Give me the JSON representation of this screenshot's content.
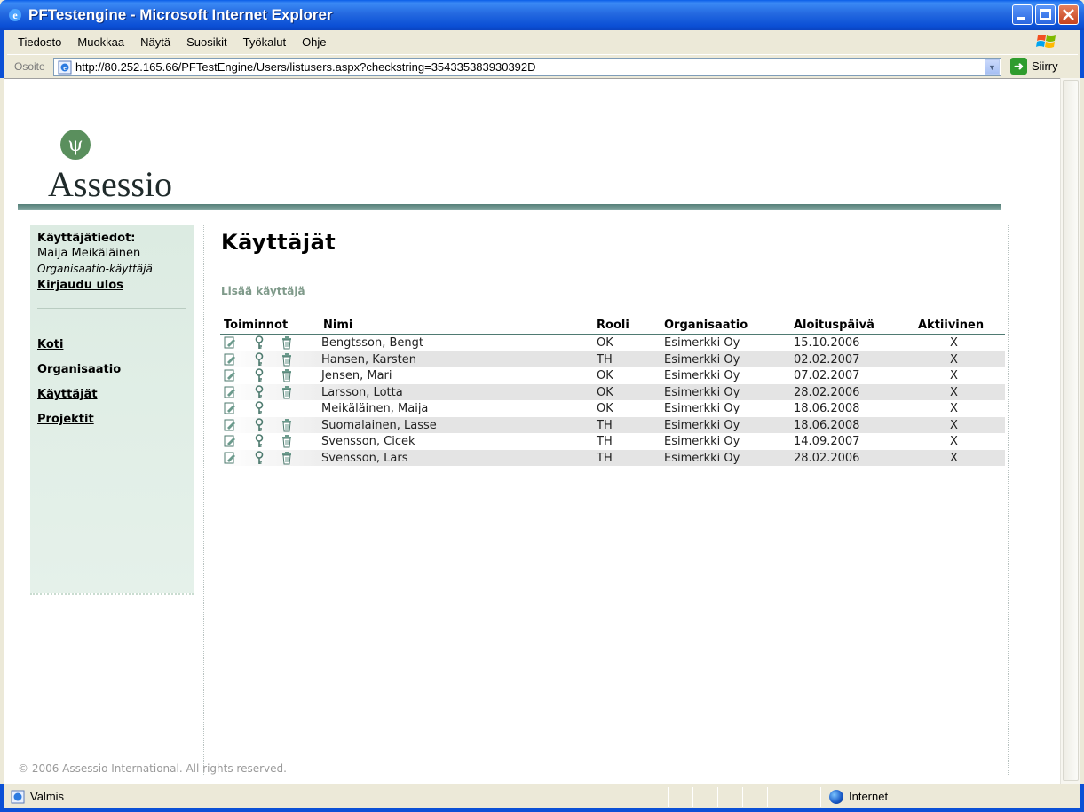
{
  "window": {
    "title": "PFTestengine - Microsoft Internet Explorer"
  },
  "menu": [
    "Tiedosto",
    "Muokkaa",
    "Näytä",
    "Suosikit",
    "Työkalut",
    "Ohje"
  ],
  "address": {
    "label": "Osoite",
    "url": "http://80.252.165.66/PFTestEngine/Users/listusers.aspx?checkstring=354335383930392D",
    "go_label": "Siirry"
  },
  "logo": {
    "text": "Assessio",
    "mark": "ψ"
  },
  "sidebar": {
    "user_heading": "Käyttäjätiedot:",
    "user_name": "Maija Meikäläinen",
    "user_role": "Organisaatio-käyttäjä",
    "logout": "Kirjaudu ulos",
    "nav": [
      "Koti",
      "Organisaatio",
      "Käyttäjät",
      "Projektit"
    ]
  },
  "page": {
    "title": "Käyttäjät",
    "add_user": "Lisää käyttäjä"
  },
  "table": {
    "headers": {
      "actions": "Toiminnot",
      "name": "Nimi",
      "role": "Rooli",
      "organisation": "Organisaatio",
      "start_date": "Aloituspäivä",
      "active": "Aktiivinen"
    },
    "rows": [
      {
        "name": "Bengtsson, Bengt",
        "role": "OK",
        "organisation": "Esimerkki Oy",
        "start_date": "15.10.2006",
        "active": "X",
        "deletable": true
      },
      {
        "name": "Hansen, Karsten",
        "role": "TH",
        "organisation": "Esimerkki Oy",
        "start_date": "02.02.2007",
        "active": "X",
        "deletable": true
      },
      {
        "name": "Jensen, Mari",
        "role": "OK",
        "organisation": "Esimerkki Oy",
        "start_date": "07.02.2007",
        "active": "X",
        "deletable": true
      },
      {
        "name": "Larsson, Lotta",
        "role": "OK",
        "organisation": "Esimerkki Oy",
        "start_date": "28.02.2006",
        "active": "X",
        "deletable": true
      },
      {
        "name": "Meikäläinen, Maija",
        "role": "OK",
        "organisation": "Esimerkki Oy",
        "start_date": "18.06.2008",
        "active": "X",
        "deletable": false
      },
      {
        "name": "Suomalainen, Lasse",
        "role": "TH",
        "organisation": "Esimerkki Oy",
        "start_date": "18.06.2008",
        "active": "X",
        "deletable": true
      },
      {
        "name": "Svensson, Cicek",
        "role": "TH",
        "organisation": "Esimerkki Oy",
        "start_date": "14.09.2007",
        "active": "X",
        "deletable": true
      },
      {
        "name": "Svensson, Lars",
        "role": "TH",
        "organisation": "Esimerkki Oy",
        "start_date": "28.02.2006",
        "active": "X",
        "deletable": true
      }
    ]
  },
  "footer": "© 2006 Assessio International. All rights reserved.",
  "status": {
    "text": "Valmis",
    "zone": "Internet"
  },
  "icons": {
    "edit": "edit-icon",
    "password": "key-icon",
    "delete": "trash-icon"
  },
  "colors": {
    "accent": "#5a8f5d",
    "rule": "#547f78",
    "sidebar": "#dcebe2"
  }
}
